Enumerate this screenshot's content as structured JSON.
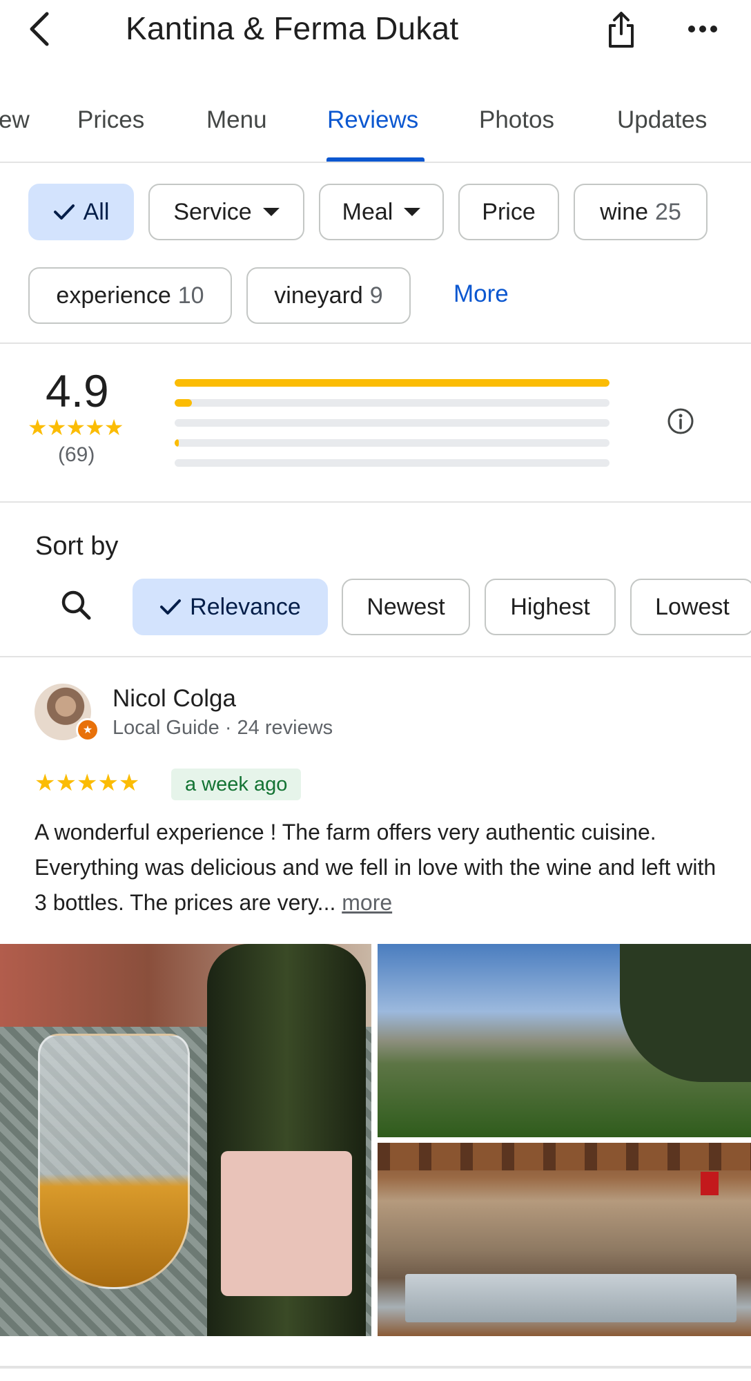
{
  "header": {
    "title": "Kantina & Ferma Dukat"
  },
  "tabs": [
    {
      "label": "ew"
    },
    {
      "label": "Prices"
    },
    {
      "label": "Menu"
    },
    {
      "label": "Reviews"
    },
    {
      "label": "Photos"
    },
    {
      "label": "Updates"
    }
  ],
  "active_tab": "Reviews",
  "filters": {
    "chips": [
      {
        "label": "All",
        "count": ""
      },
      {
        "label": "Service",
        "count": ""
      },
      {
        "label": "Meal",
        "count": ""
      },
      {
        "label": "Price",
        "count": ""
      },
      {
        "label": "wine",
        "count": "25"
      },
      {
        "label": "experience",
        "count": "10"
      },
      {
        "label": "vineyard",
        "count": "9"
      }
    ],
    "more_label": "More"
  },
  "summary": {
    "average": "4.9",
    "stars": "★★★★★",
    "count": "(69)",
    "distribution": [
      {
        "stars": 5,
        "fraction": 1.0
      },
      {
        "stars": 4,
        "fraction": 0.04
      },
      {
        "stars": 3,
        "fraction": 0.0
      },
      {
        "stars": 2,
        "fraction": 0.01
      },
      {
        "stars": 1,
        "fraction": 0.0
      }
    ]
  },
  "sort": {
    "label": "Sort by",
    "options": [
      "Relevance",
      "Newest",
      "Highest",
      "Lowest"
    ],
    "selected": "Relevance"
  },
  "review": {
    "name": "Nicol Colga",
    "meta": "Local Guide · 24 reviews",
    "stars": "★★★★★",
    "date": "a week ago",
    "text": "A wonderful experience ! The farm offers very authentic cuisine. Everything was delicious and we fell in love with the wine and left with 3 bottles. The prices are very...",
    "more_label": "more"
  },
  "colors": {
    "accent": "#0b57d0",
    "star": "#fbbc04",
    "chip_selected_bg": "#d3e3fd",
    "date_bg": "#e6f4ea",
    "date_text": "#137333"
  }
}
